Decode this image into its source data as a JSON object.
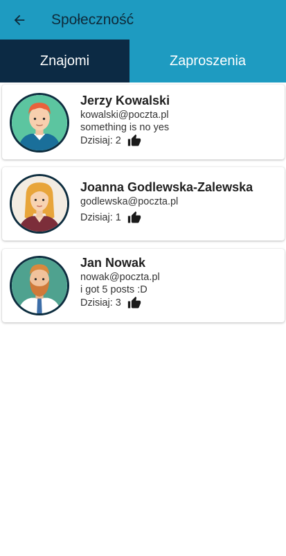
{
  "appbar": {
    "title": "Społeczność",
    "back_icon": "arrow-left-icon"
  },
  "tabs": [
    {
      "label": "Znajomi",
      "active": true
    },
    {
      "label": "Zaproszenia",
      "active": false
    }
  ],
  "friends": [
    {
      "name": "Jerzy Kowalski",
      "email": "kowalski@poczta.pl",
      "status": "something is no yes",
      "likes_label": "Dzisiaj: 2",
      "avatar": "male-redhead-avatar"
    },
    {
      "name": "Joanna Godlewska-Zalewska",
      "email": "godlewska@poczta.pl",
      "status": "",
      "likes_label": "Dzisiaj: 1",
      "avatar": "female-blonde-avatar"
    },
    {
      "name": "Jan Nowak",
      "email": "nowak@poczta.pl",
      "status": "i got 5 posts :D",
      "likes_label": "Dzisiaj: 3",
      "avatar": "male-bearded-avatar"
    }
  ],
  "colors": {
    "primary": "#1e9bc1",
    "tab_active": "#0c2a44"
  }
}
